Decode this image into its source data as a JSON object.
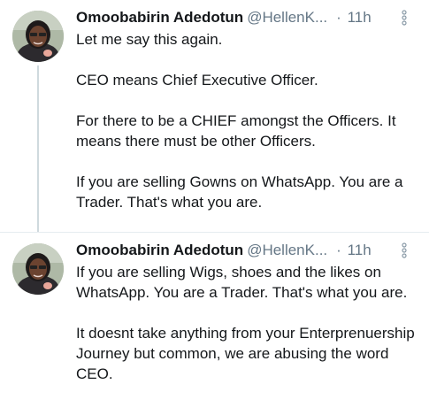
{
  "tweets": [
    {
      "author_name": "Omoobabirin Adedotun",
      "handle": "@HellenK...",
      "separator": "·",
      "time": "11h",
      "paragraphs": [
        "Let me say this again.",
        "CEO means Chief Executive Officer.",
        "For there to be a CHIEF amongst the Officers. It means there must be other Officers.",
        "If you are selling Gowns on WhatsApp. You are a Trader.  That's what you are."
      ]
    },
    {
      "author_name": "Omoobabirin Adedotun",
      "handle": "@HellenK...",
      "separator": "·",
      "time": "11h",
      "paragraphs": [
        "If you are selling Wigs, shoes and the likes on WhatsApp. You are a Trader.  That's what you are.",
        "It doesnt take anything from your Enterprenuership Journey but common, we are abusing the word CEO."
      ]
    }
  ],
  "icons": {
    "more": "vertical-dots-icon"
  },
  "colors": {
    "text": "#14171a",
    "secondary": "#657786",
    "thread_line": "#cfd9de"
  }
}
